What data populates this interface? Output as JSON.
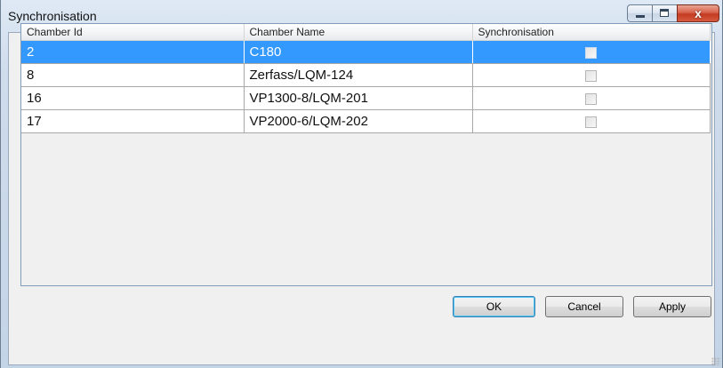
{
  "window": {
    "title": "Synchronisation",
    "controls": {
      "close_glyph": "x"
    }
  },
  "grid": {
    "columns": [
      "Chamber Id",
      "Chamber Name",
      "Synchronisation"
    ],
    "rows": [
      {
        "id": "2",
        "name": "C180",
        "synchronised": false,
        "selected": true
      },
      {
        "id": "8",
        "name": "Zerfass/LQM-124",
        "synchronised": false,
        "selected": false
      },
      {
        "id": "16",
        "name": "VP1300-8/LQM-201",
        "synchronised": false,
        "selected": false
      },
      {
        "id": "17",
        "name": "VP2000-6/LQM-202",
        "synchronised": false,
        "selected": false
      }
    ],
    "selection_color": "#3399ff"
  },
  "buttons": {
    "ok": "OK",
    "cancel": "Cancel",
    "apply": "Apply"
  },
  "icons": [
    "minimize-icon",
    "maximize-icon",
    "close-icon",
    "resize-grip-icon"
  ]
}
